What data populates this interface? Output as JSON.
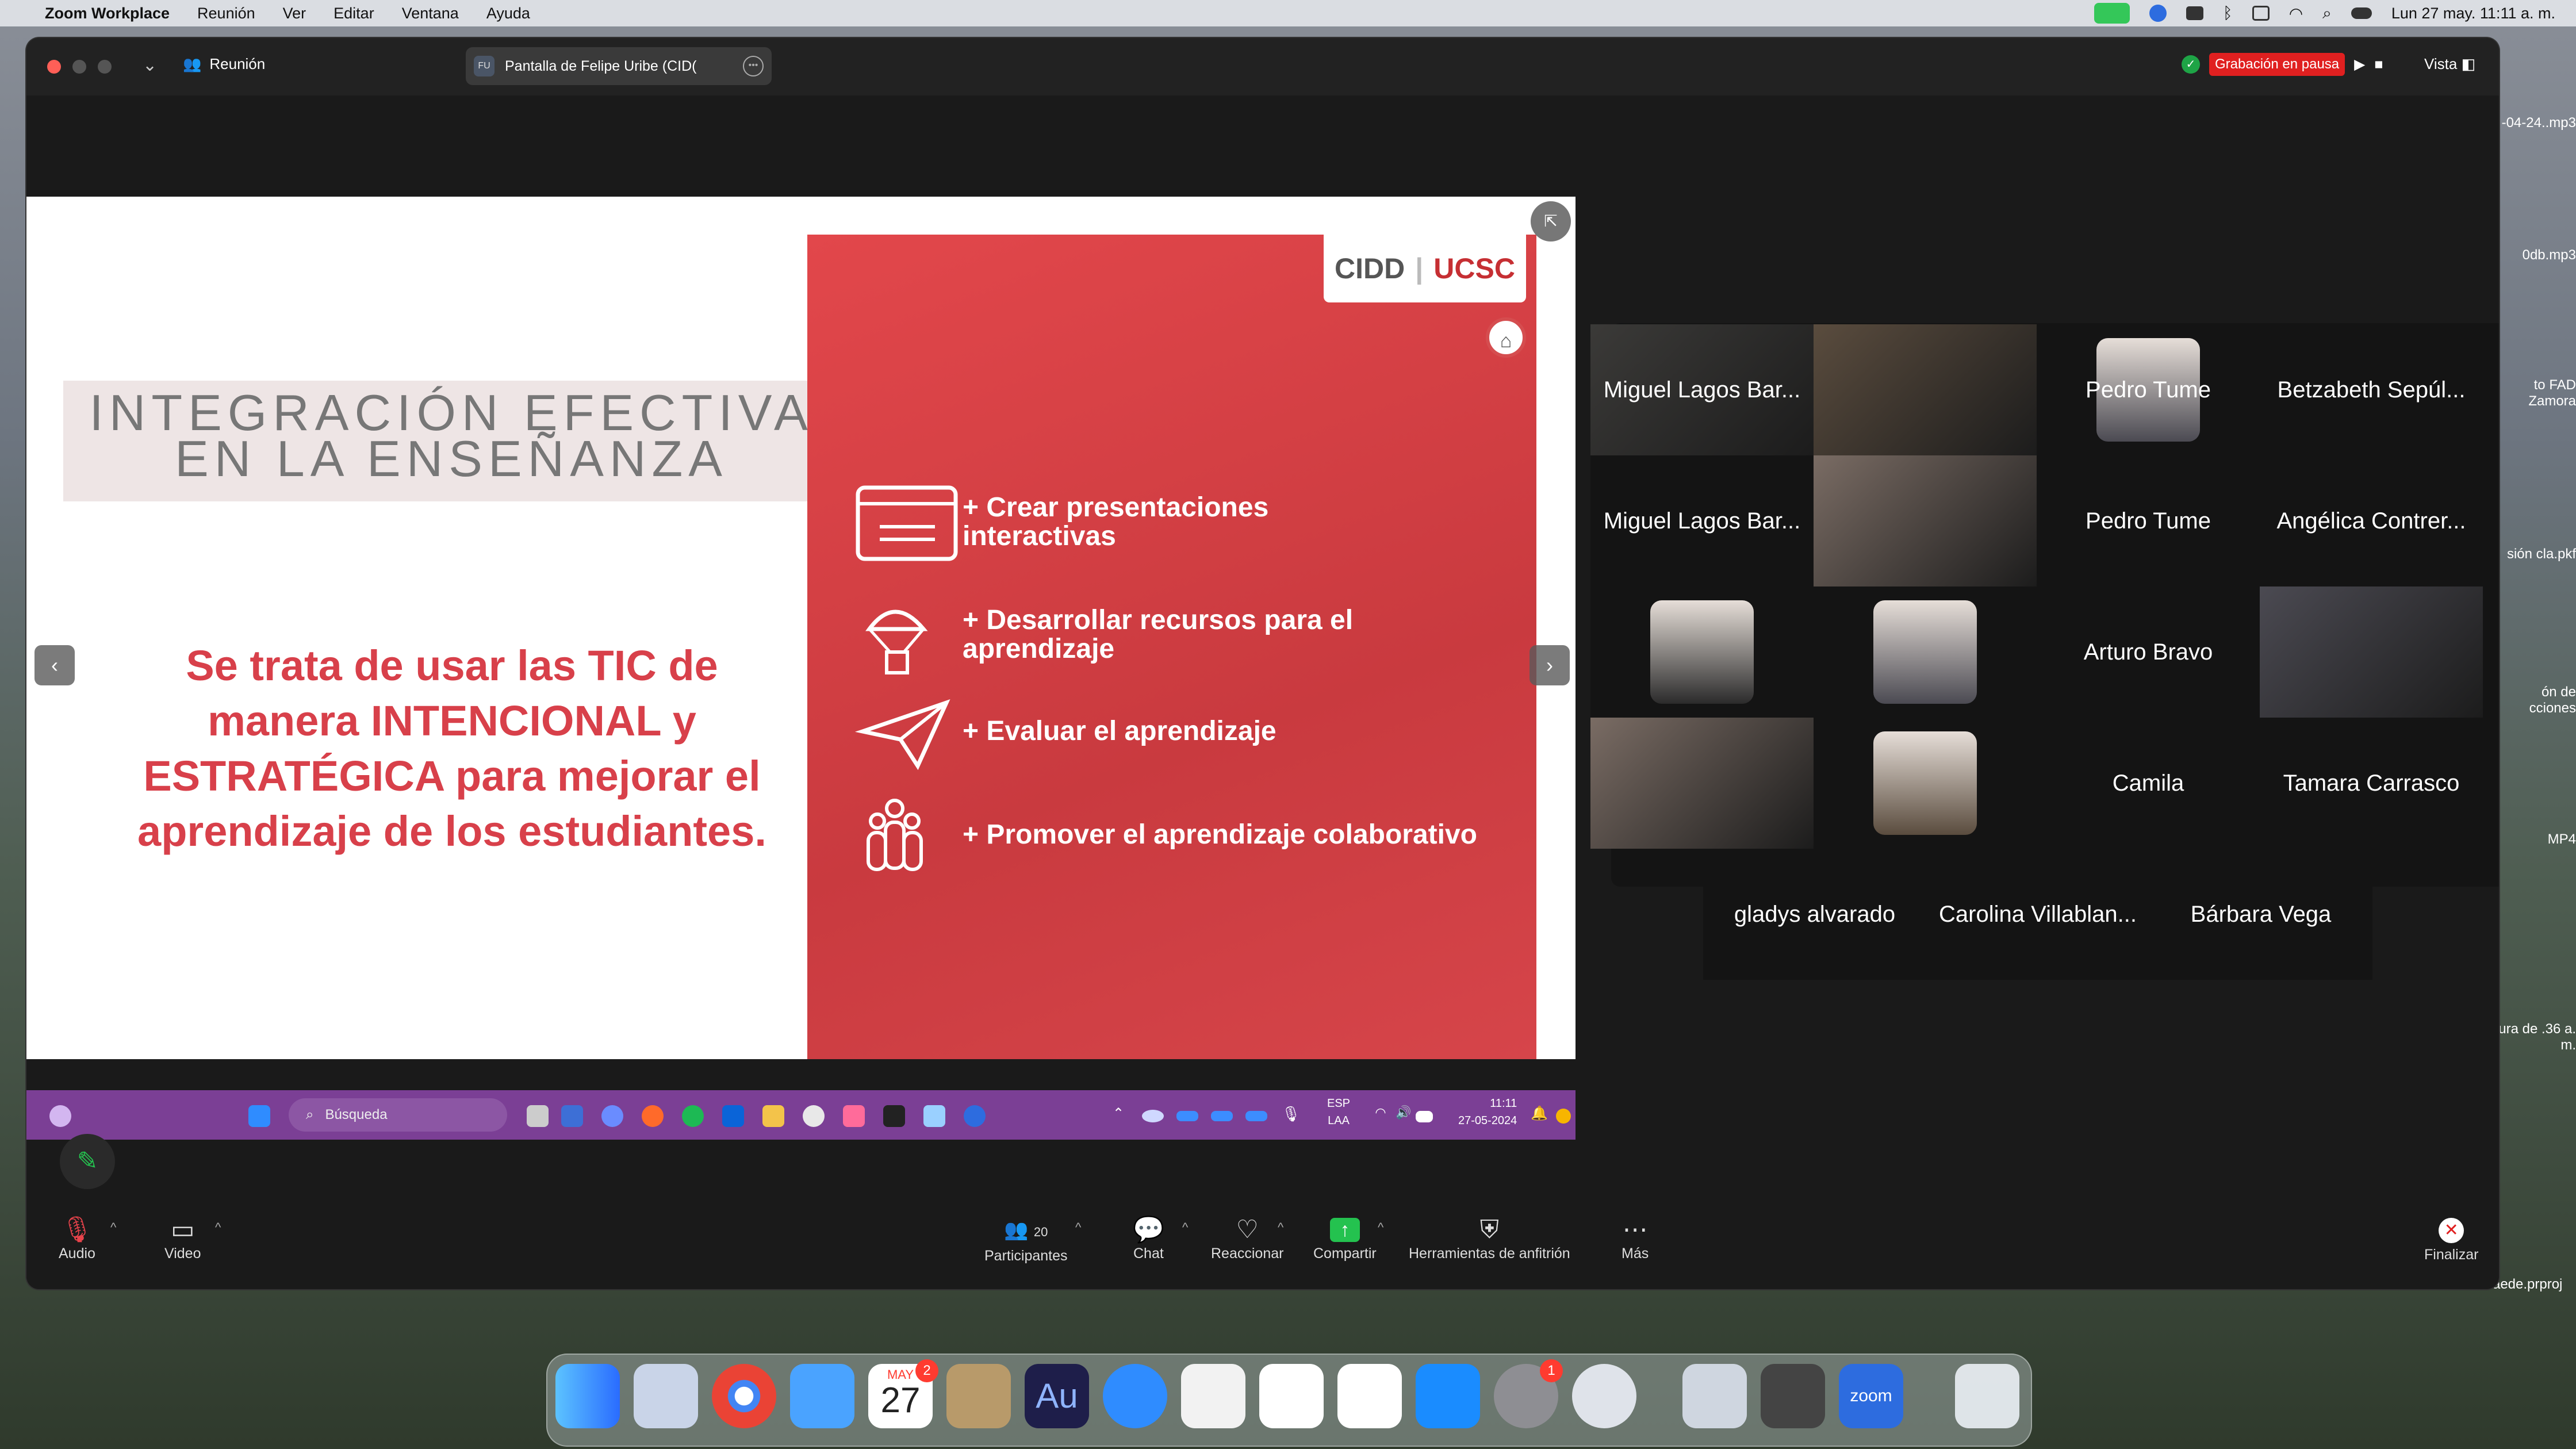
{
  "menubar": {
    "app": "Zoom Workplace",
    "items": [
      "Reunión",
      "Ver",
      "Editar",
      "Ventana",
      "Ayuda"
    ],
    "clock": "Lun 27 may.  11:11 a. m."
  },
  "window": {
    "meeting_label": "Reunión",
    "share_tab": "Pantalla de Felipe Uribe (CID(",
    "share_tab_initials": "FU",
    "recording": "Grabación en pausa",
    "view": "Vista"
  },
  "slide": {
    "title_line1": "INTEGRACIÓN EFECTIVA",
    "title_line2": "EN LA ENSEÑANZA",
    "body": "Se trata de usar las TIC de manera INTENCIONAL y ESTRATÉGICA para mejorar el aprendizaje de los estudiantes.",
    "logo_left": "CIDD",
    "logo_right": "UCSC",
    "items": [
      {
        "line1": "+ Crear presentaciones",
        "line2": "interactivas",
        "icon": "presentation-icon"
      },
      {
        "line1": "+ Desarrollar recursos para el",
        "line2": "aprendizaje",
        "icon": "parachute-icon"
      },
      {
        "line1": "+ Evaluar el aprendizaje",
        "line2": "",
        "icon": "paper-plane-icon"
      },
      {
        "line1": "+ Promover el aprendizaje colaborativo",
        "line2": "",
        "icon": "group-icon"
      }
    ]
  },
  "win_taskbar": {
    "search": "Búsqueda",
    "lang1": "ESP",
    "lang2": "LAA",
    "time": "11:11",
    "date": "27-05-2024"
  },
  "participants": [
    {
      "name": "Miguel Lagos Bar...",
      "video": true,
      "active": true
    },
    {
      "name": "",
      "video": true
    },
    {
      "name": "Pedro Tume",
      "avatar": true
    },
    {
      "name": "Betzabeth Sepúl..."
    },
    {
      "name": "Miguel Lagos Bar..."
    },
    {
      "name": "",
      "video": true
    },
    {
      "name": "Pedro Tume"
    },
    {
      "name": "Angélica Contrer..."
    },
    {
      "name": "",
      "avatar": true
    },
    {
      "name": "",
      "avatar": true
    },
    {
      "name": "Arturo Bravo"
    },
    {
      "name": "",
      "video": true
    },
    {
      "name": "",
      "video": true
    },
    {
      "name": "",
      "avatar": true
    },
    {
      "name": "Camila"
    },
    {
      "name": "Tamara Carrasco"
    },
    {
      "name": "gladys alvarado"
    },
    {
      "name": "Carolina Villablan..."
    },
    {
      "name": "Bárbara Vega"
    }
  ],
  "toolbar": {
    "audio": "Audio",
    "video": "Video",
    "participants": "Participantes",
    "participants_count": "20",
    "chat": "Chat",
    "react": "Reaccionar",
    "share": "Compartir",
    "host_tools": "Herramientas de anfitrión",
    "more": "Más",
    "end": "Finalizar"
  },
  "desktop": {
    "files": [
      "-04-24..mp3",
      "0db.mp3",
      "to FAD Zamora",
      "sión cla.pkf",
      "ón de cciones",
      "MP4",
      "ura de .36 a. m.",
      "videoscaede.prproj"
    ]
  },
  "dock": {
    "calendar_month": "MAY",
    "calendar_day": "27",
    "calendar_badge": "2",
    "settings_badge": "1",
    "audition": "Au",
    "zoom": "zoom"
  },
  "colors": {
    "slide_red": "#d6454a",
    "accent_green": "#2bc14a",
    "record_red": "#e02020",
    "taskbar_purple": "#7b3f95"
  }
}
